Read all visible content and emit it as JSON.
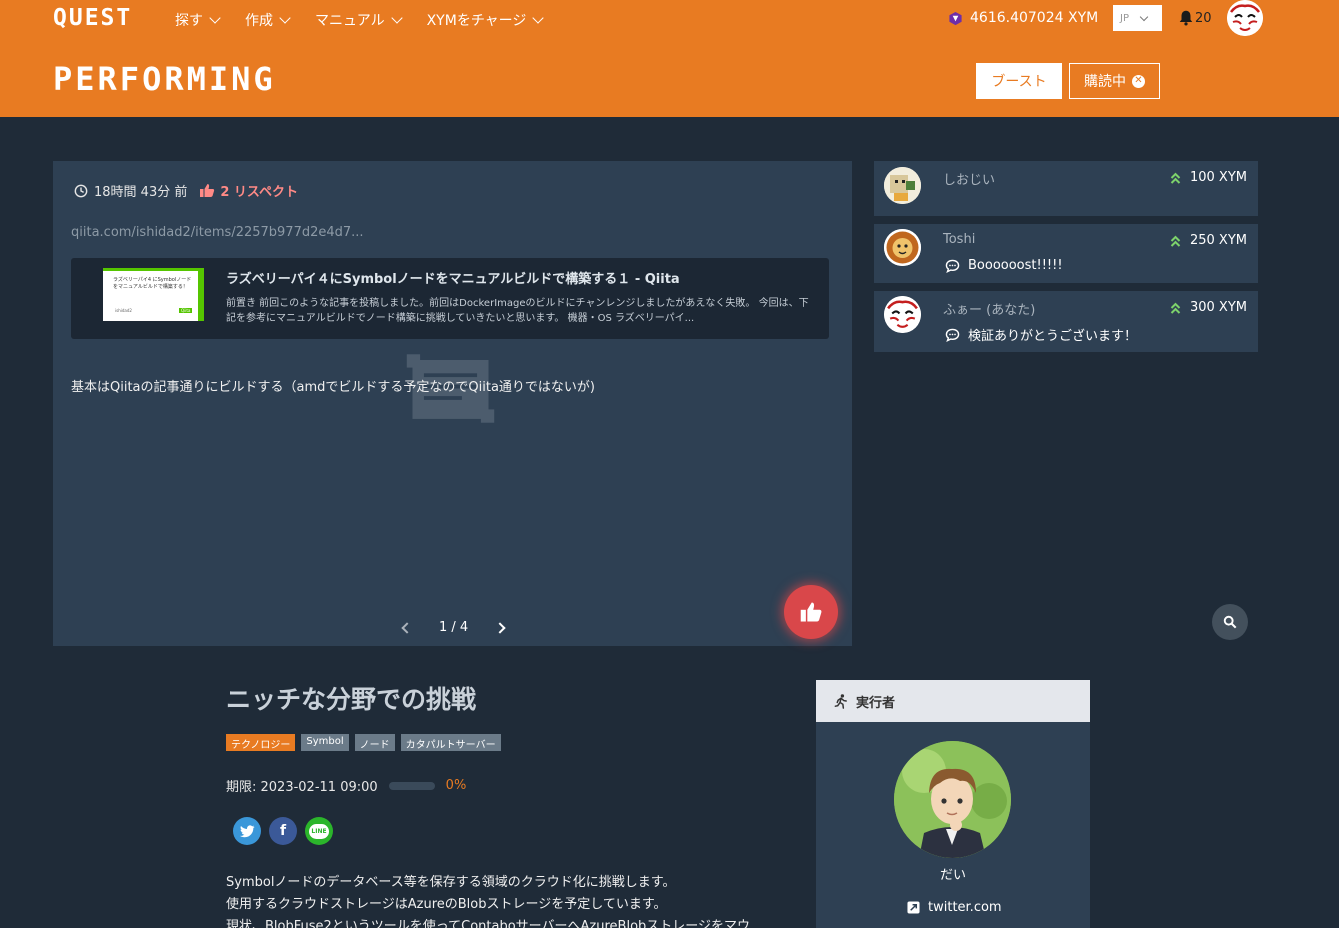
{
  "header": {
    "logo": "QUEST",
    "nav": [
      {
        "label": "探す"
      },
      {
        "label": "作成"
      },
      {
        "label": "マニュアル"
      },
      {
        "label": "XYMをチャージ"
      }
    ],
    "balance": "4616.407024 XYM",
    "language": "JP",
    "notification_count": "20",
    "page_heading": "PERFORMING",
    "boost_label": "ブースト",
    "subscribing_label": "購読中",
    "subscribing_close": "✕"
  },
  "post": {
    "time_ago": "18時間 43分 前",
    "respect": "2 リスペクト",
    "link": "qiita.com/ishidad2/items/2257b977d2e4d7...",
    "preview": {
      "thumb_line1": "ラズベリーパイ4 にSymbolノード",
      "thumb_line2": "をマニュアルビルドで構築する！",
      "thumb_author": "ishidad2",
      "thumb_badge": "Qiita",
      "title": "ラズベリーパイ４にSymbolノードをマニュアルビルドで構築する１ - Qiita",
      "description": "前置き 前回このような記事を投稿しました。前回はDockerImageのビルドにチャンレンジしましたがあえなく失敗。 今回は、下記を参考にマニュアルビルドでノード構築に挑戦していきたいと思います。 機器・OS ラズベリーパイ..."
    },
    "body": "基本はQiitaの記事通りにビルドする（amdでビルドする予定なのでQiita通りではないが)",
    "page_indicator": "1 / 4"
  },
  "boosts": [
    {
      "name": "しおじい",
      "amount": "100 XYM",
      "message": ""
    },
    {
      "name": "Toshi",
      "amount": "250 XYM",
      "message": "Boooooost!!!!!"
    },
    {
      "name": "ふぁー (あなた)",
      "amount": "300 XYM",
      "message": "検証ありがとうございます！"
    }
  ],
  "quest": {
    "title": "ニッチな分野での挑戦",
    "tags": [
      "テクノロジー",
      "Symbol",
      "ノード",
      "カタパルトサーバー"
    ],
    "deadline": "期限: 2023-02-11 09:00",
    "progress_percent": 0,
    "progress_label": "0%",
    "share": {
      "twitter": "t",
      "facebook": "f",
      "line": "LINE"
    },
    "description": [
      "Symbolノードのデータベース等を保存する領域のクラウド化に挑戦します。",
      "使用するクラウドストレージはAzureのBlobストレージを予定しています。",
      "現状、BlobFuse2というツールを使ってContaboサーバーへAzureBlobストレージをマウ"
    ]
  },
  "executor": {
    "heading": "実行者",
    "name": "だい",
    "link": "twitter.com"
  },
  "colors": {
    "accent": "#e87b22",
    "background": "#1f2b38",
    "card": "#2e4053",
    "like": "#d9474a",
    "boost_arrow": "#7dd36b"
  }
}
